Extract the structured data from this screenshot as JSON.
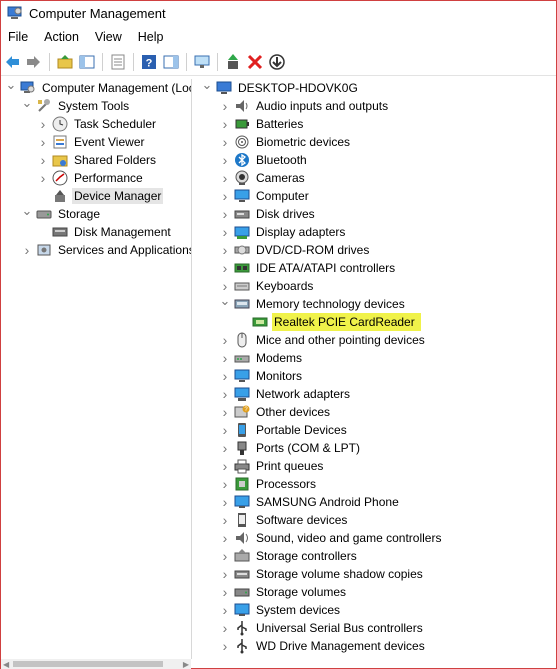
{
  "window": {
    "title": "Computer Management"
  },
  "menu": [
    "File",
    "Action",
    "View",
    "Help"
  ],
  "toolbar_icons": [
    "back-icon",
    "forward-icon",
    "up-folder-icon",
    "show-hide-tree-icon",
    "properties-icon",
    "help-icon",
    "show-action-pane-icon",
    "monitor-icon",
    "update-driver-icon",
    "uninstall-icon",
    "download-icon"
  ],
  "left_tree": [
    {
      "label": "Computer Management (Local",
      "depth": 0,
      "exp": "v",
      "icon": "computer-management-icon"
    },
    {
      "label": "System Tools",
      "depth": 1,
      "exp": "v",
      "icon": "tools-icon"
    },
    {
      "label": "Task Scheduler",
      "depth": 2,
      "exp": ">",
      "icon": "clock-icon"
    },
    {
      "label": "Event Viewer",
      "depth": 2,
      "exp": ">",
      "icon": "event-viewer-icon"
    },
    {
      "label": "Shared Folders",
      "depth": 2,
      "exp": ">",
      "icon": "shared-folder-icon"
    },
    {
      "label": "Performance",
      "depth": 2,
      "exp": ">",
      "icon": "performance-icon"
    },
    {
      "label": "Device Manager",
      "depth": 2,
      "exp": "",
      "icon": "device-manager-icon",
      "selected": true
    },
    {
      "label": "Storage",
      "depth": 1,
      "exp": "v",
      "icon": "storage-icon"
    },
    {
      "label": "Disk Management",
      "depth": 2,
      "exp": "",
      "icon": "disk-icon"
    },
    {
      "label": "Services and Applications",
      "depth": 1,
      "exp": ">",
      "icon": "services-icon"
    }
  ],
  "right_tree": [
    {
      "label": "DESKTOP-HDOVK0G",
      "depth": 0,
      "exp": "v",
      "icon": "desktop-computer-icon"
    },
    {
      "label": "Audio inputs and outputs",
      "depth": 1,
      "exp": ">",
      "icon": "speaker-icon"
    },
    {
      "label": "Batteries",
      "depth": 1,
      "exp": ">",
      "icon": "battery-icon"
    },
    {
      "label": "Biometric devices",
      "depth": 1,
      "exp": ">",
      "icon": "fingerprint-icon"
    },
    {
      "label": "Bluetooth",
      "depth": 1,
      "exp": ">",
      "icon": "bluetooth-icon"
    },
    {
      "label": "Cameras",
      "depth": 1,
      "exp": ">",
      "icon": "camera-icon"
    },
    {
      "label": "Computer",
      "depth": 1,
      "exp": ">",
      "icon": "monitor-icon"
    },
    {
      "label": "Disk drives",
      "depth": 1,
      "exp": ">",
      "icon": "disk-drive-icon"
    },
    {
      "label": "Display adapters",
      "depth": 1,
      "exp": ">",
      "icon": "display-adapter-icon"
    },
    {
      "label": "DVD/CD-ROM drives",
      "depth": 1,
      "exp": ">",
      "icon": "dvd-icon"
    },
    {
      "label": "IDE ATA/ATAPI controllers",
      "depth": 1,
      "exp": ">",
      "icon": "ide-controller-icon"
    },
    {
      "label": "Keyboards",
      "depth": 1,
      "exp": ">",
      "icon": "keyboard-icon"
    },
    {
      "label": "Memory technology devices",
      "depth": 1,
      "exp": "v",
      "icon": "memory-device-icon"
    },
    {
      "label": "Realtek PCIE CardReader",
      "depth": 2,
      "exp": "",
      "icon": "card-reader-icon",
      "highlight": true
    },
    {
      "label": "Mice and other pointing devices",
      "depth": 1,
      "exp": ">",
      "icon": "mouse-icon"
    },
    {
      "label": "Modems",
      "depth": 1,
      "exp": ">",
      "icon": "modem-icon"
    },
    {
      "label": "Monitors",
      "depth": 1,
      "exp": ">",
      "icon": "monitor-icon"
    },
    {
      "label": "Network adapters",
      "depth": 1,
      "exp": ">",
      "icon": "network-icon"
    },
    {
      "label": "Other devices",
      "depth": 1,
      "exp": ">",
      "icon": "other-devices-icon"
    },
    {
      "label": "Portable Devices",
      "depth": 1,
      "exp": ">",
      "icon": "portable-device-icon"
    },
    {
      "label": "Ports (COM & LPT)",
      "depth": 1,
      "exp": ">",
      "icon": "port-icon"
    },
    {
      "label": "Print queues",
      "depth": 1,
      "exp": ">",
      "icon": "printer-icon"
    },
    {
      "label": "Processors",
      "depth": 1,
      "exp": ">",
      "icon": "processor-icon"
    },
    {
      "label": "SAMSUNG Android Phone",
      "depth": 1,
      "exp": ">",
      "icon": "phone-icon"
    },
    {
      "label": "Software devices",
      "depth": 1,
      "exp": ">",
      "icon": "software-device-icon"
    },
    {
      "label": "Sound, video and game controllers",
      "depth": 1,
      "exp": ">",
      "icon": "sound-icon"
    },
    {
      "label": "Storage controllers",
      "depth": 1,
      "exp": ">",
      "icon": "storage-controller-icon"
    },
    {
      "label": "Storage volume shadow copies",
      "depth": 1,
      "exp": ">",
      "icon": "shadow-copy-icon"
    },
    {
      "label": "Storage volumes",
      "depth": 1,
      "exp": ">",
      "icon": "storage-volume-icon"
    },
    {
      "label": "System devices",
      "depth": 1,
      "exp": ">",
      "icon": "system-device-icon"
    },
    {
      "label": "Universal Serial Bus controllers",
      "depth": 1,
      "exp": ">",
      "icon": "usb-icon"
    },
    {
      "label": "WD Drive Management devices",
      "depth": 1,
      "exp": ">",
      "icon": "wd-drive-icon"
    }
  ],
  "colors": {
    "highlight": "#f0f24a",
    "selection": "#e5e5e5",
    "accent": "#1e78c8",
    "delete": "#e02020",
    "border": "#d04040"
  }
}
